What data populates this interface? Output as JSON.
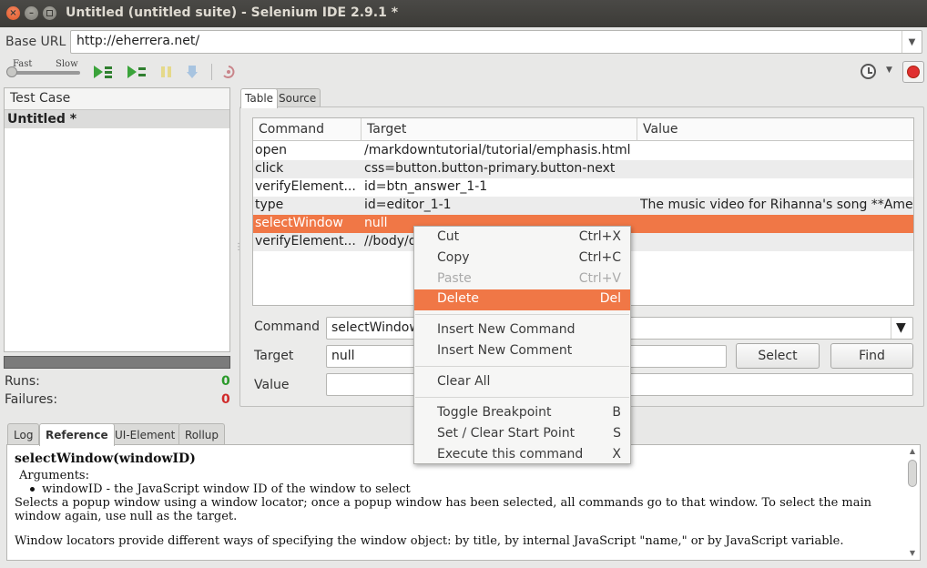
{
  "window": {
    "title": "Untitled (untitled suite) - Selenium IDE 2.9.1 *",
    "close_glyph": "×",
    "min_glyph": "–"
  },
  "base_url": {
    "label": "Base URL",
    "value": "http://eherrera.net/"
  },
  "toolbar": {
    "speed_fast": "Fast",
    "speed_slow": "Slow",
    "speed_value": 0
  },
  "test_case_panel": {
    "header": "Test Case",
    "items": [
      "Untitled *"
    ],
    "runs_label": "Runs:",
    "runs_value": "0",
    "failures_label": "Failures:",
    "failures_value": "0"
  },
  "editor_tabs": [
    "Table",
    "Source"
  ],
  "table": {
    "columns": [
      "Command",
      "Target",
      "Value"
    ],
    "rows": [
      {
        "command": "open",
        "target": "/markdowntutorial/tutorial/emphasis.html",
        "value": ""
      },
      {
        "command": "click",
        "target": "css=button.button-primary.button-next",
        "value": ""
      },
      {
        "command": "verifyElement...",
        "target": "id=btn_answer_1-1",
        "value": ""
      },
      {
        "command": "type",
        "target": "id=editor_1-1",
        "value": "The music video for Rihanna's song **Ame..."
      },
      {
        "command": "selectWindow",
        "target": "null",
        "value": ""
      },
      {
        "command": "verifyElement...",
        "target": "//body/d",
        "value": ""
      }
    ]
  },
  "form": {
    "command_label": "Command",
    "command_value": "selectWindow",
    "target_label": "Target",
    "target_value": "null",
    "value_label": "Value",
    "value_value": "",
    "select_button": "Select",
    "find_button": "Find"
  },
  "bottom_tabs": [
    "Log",
    "Reference",
    "UI-Element",
    "Rollup"
  ],
  "reference": {
    "title": "selectWindow(windowID)",
    "arguments_label": "Arguments:",
    "argument": "windowID - the JavaScript window ID of the window to select",
    "para1": "Selects a popup window using a window locator; once a popup window has been selected, all commands go to that window. To select the main window again, use null as the target.",
    "para2": "Window locators provide different ways of specifying the window object: by title, by internal JavaScript \"name,\" or by JavaScript variable."
  },
  "context_menu": {
    "items": [
      {
        "label": "Cut",
        "shortcut": "Ctrl+X"
      },
      {
        "label": "Copy",
        "shortcut": "Ctrl+C"
      },
      {
        "label": "Paste",
        "shortcut": "Ctrl+V"
      },
      {
        "label": "Delete",
        "shortcut": "Del"
      },
      {
        "label": "Insert New Command",
        "shortcut": ""
      },
      {
        "label": "Insert New Comment",
        "shortcut": ""
      },
      {
        "label": "Clear All",
        "shortcut": ""
      },
      {
        "label": "Toggle Breakpoint",
        "shortcut": "B"
      },
      {
        "label": "Set / Clear Start Point",
        "shortcut": "S"
      },
      {
        "label": "Execute this command",
        "shortcut": "X"
      }
    ]
  },
  "colors": {
    "accent": "#f07746",
    "runs_ok": "#2a9a2a",
    "failures": "#d02a2a",
    "record": "#e03030"
  }
}
